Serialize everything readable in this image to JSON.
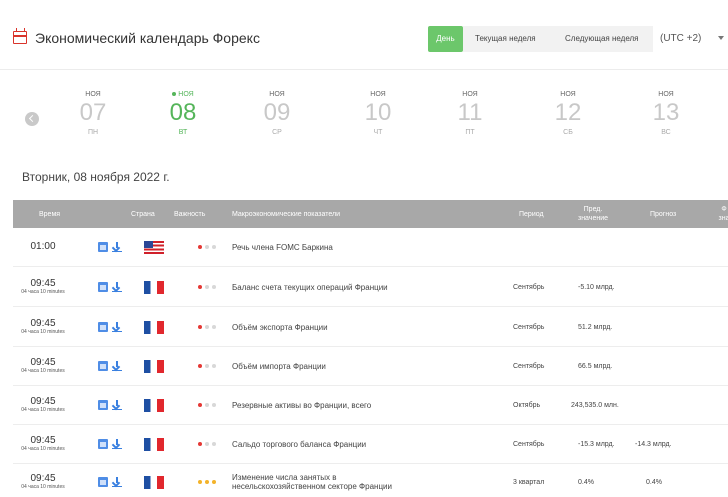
{
  "header": {
    "title": "Экономический календарь Форекс",
    "day_button": "День",
    "current_week": "Текущая неделя",
    "next_week": "Следующая неделя",
    "timezone": "(UTC +2)"
  },
  "days": [
    {
      "mon": "НОЯ",
      "num": "07",
      "dow": "ПН",
      "active": false
    },
    {
      "mon": "НОЯ",
      "num": "08",
      "dow": "ВТ",
      "active": true
    },
    {
      "mon": "НОЯ",
      "num": "09",
      "dow": "СР",
      "active": false
    },
    {
      "mon": "НОЯ",
      "num": "10",
      "dow": "ЧТ",
      "active": false
    },
    {
      "mon": "НОЯ",
      "num": "11",
      "dow": "ПТ",
      "active": false
    },
    {
      "mon": "НОЯ",
      "num": "12",
      "dow": "СБ",
      "active": false
    },
    {
      "mon": "НОЯ",
      "num": "13",
      "dow": "ВС",
      "active": false
    }
  ],
  "date_heading": "Вторник, 08 ноября 2022 г.",
  "table": {
    "headers": {
      "time": "Время",
      "country": "Страна",
      "importance": "Важность",
      "indicator": "Макроэкономические показатели",
      "period": "Период",
      "prev_line1": "Пред.",
      "prev_line2": "значение",
      "forecast": "Прогноз",
      "actual_line1": "Ф",
      "actual_line2": "зна"
    },
    "importance_colors": {
      "red": "#e53935",
      "yellow": "#f3b32a",
      "grey": "#d8d8d8"
    },
    "rows": [
      {
        "time": "01:00",
        "sub": "",
        "flag": "us",
        "importance": [
          1,
          0,
          0
        ],
        "color": "red",
        "indicator": [
          "Речь члена FOMC Баркина"
        ],
        "period": "",
        "prev": "",
        "forecast": ""
      },
      {
        "time": "09:45",
        "sub": "04 часа 10 minutes",
        "flag": "fr",
        "importance": [
          1,
          0,
          0
        ],
        "color": "red",
        "indicator": [
          "Баланс счета текущих операций Франции"
        ],
        "period": "Сентябрь",
        "prev": "-5.10 млрд.",
        "forecast": ""
      },
      {
        "time": "09:45",
        "sub": "04 часа 10 minutes",
        "flag": "fr",
        "importance": [
          1,
          0,
          0
        ],
        "color": "red",
        "indicator": [
          "Объём экспорта Франции"
        ],
        "period": "Сентябрь",
        "prev": "51.2 млрд.",
        "forecast": ""
      },
      {
        "time": "09:45",
        "sub": "04 часа 10 minutes",
        "flag": "fr",
        "importance": [
          1,
          0,
          0
        ],
        "color": "red",
        "indicator": [
          "Объём импорта Франции"
        ],
        "period": "Сентябрь",
        "prev": "66.5 млрд.",
        "forecast": ""
      },
      {
        "time": "09:45",
        "sub": "04 часа 10 minutes",
        "flag": "fr",
        "importance": [
          1,
          0,
          0
        ],
        "color": "red",
        "indicator": [
          "Резервные активы во Франции, всего"
        ],
        "period": "Октябрь",
        "prev": "243,535.0 млн.",
        "forecast": ""
      },
      {
        "time": "09:45",
        "sub": "04 часа 10 minutes",
        "flag": "fr",
        "importance": [
          1,
          0,
          0
        ],
        "color": "red",
        "indicator": [
          "Сальдо торгового баланса Франции"
        ],
        "period": "Сентябрь",
        "prev": "-15.3 млрд.",
        "forecast": "-14.3 млрд."
      },
      {
        "time": "09:45",
        "sub": "04 часа 10 minutes",
        "flag": "fr",
        "importance": [
          1,
          1,
          1
        ],
        "color": "yellow",
        "indicator": [
          "Изменение числа занятых в",
          "несельскохозяйственном секторе Франции"
        ],
        "period": "3 квартал",
        "prev": "0.4%",
        "forecast": "0.4%"
      }
    ]
  }
}
